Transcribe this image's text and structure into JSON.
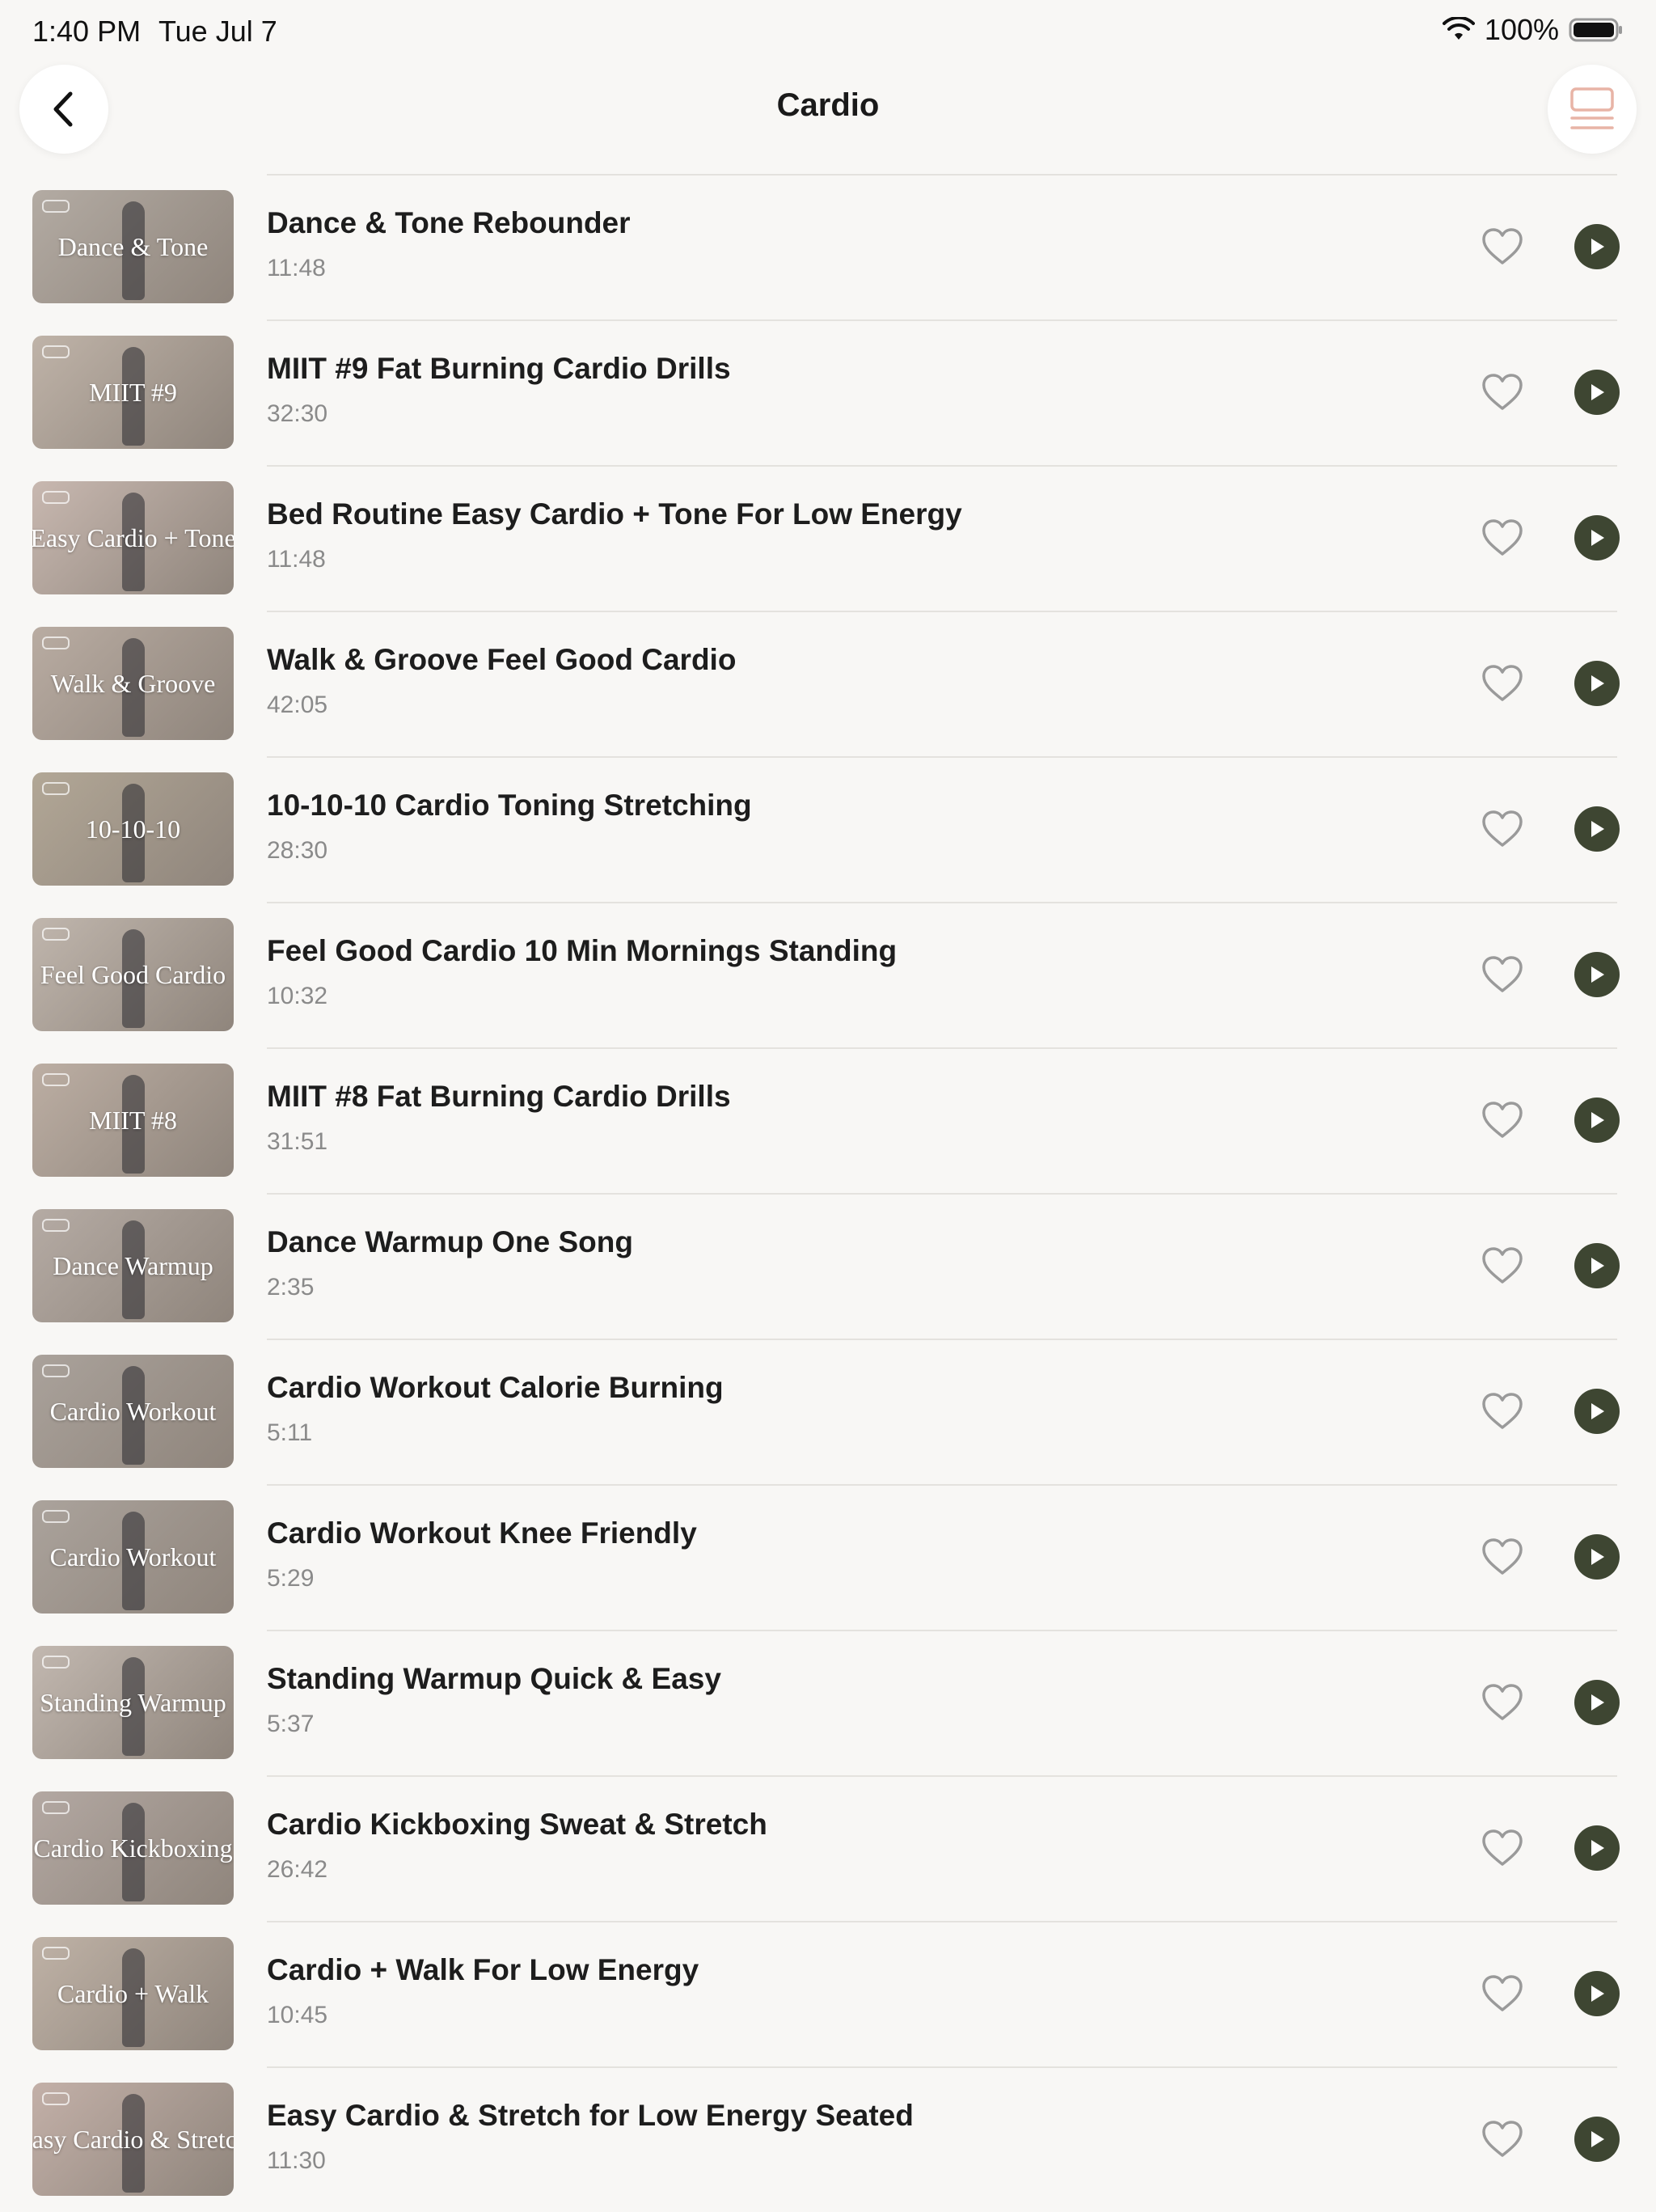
{
  "status_bar": {
    "time": "1:40 PM",
    "date": "Tue Jul 7",
    "battery": "100%"
  },
  "header": {
    "title": "Cardio",
    "back_icon": "chevron-left-icon",
    "layout_icon": "list-layout-icon"
  },
  "colors": {
    "background": "#f8f7f5",
    "play_button": "#3e4632",
    "heart_outline": "#9a9a9a",
    "layout_icon": "#e8b4a6"
  },
  "workouts": [
    {
      "title": "Dance & Tone Rebounder",
      "duration": "11:48",
      "thumb_text": "Dance & Tone",
      "thumb_color": "#b3aba3"
    },
    {
      "title": "MIIT #9 Fat Burning Cardio Drills",
      "duration": "32:30",
      "thumb_text": "MIIT #9",
      "thumb_color": "#bfb3a8"
    },
    {
      "title": "Bed Routine Easy Cardio + Tone For Low Energy",
      "duration": "11:48",
      "thumb_text": "Easy Cardio + Tone",
      "thumb_color": "#c8b8b0"
    },
    {
      "title": "Walk & Groove Feel Good Cardio",
      "duration": "42:05",
      "thumb_text": "Walk & Groove",
      "thumb_color": "#b9aca2"
    },
    {
      "title": "10-10-10 Cardio Toning Stretching",
      "duration": "28:30",
      "thumb_text": "10-10-10",
      "thumb_color": "#b2a796"
    },
    {
      "title": "Feel Good Cardio 10 Min Mornings Standing",
      "duration": "10:32",
      "thumb_text": "Feel Good Cardio",
      "thumb_color": "#c0b6ad"
    },
    {
      "title": "MIIT #8 Fat Burning Cardio Drills",
      "duration": "31:51",
      "thumb_text": "MIIT #8",
      "thumb_color": "#bcaea3"
    },
    {
      "title": "Dance Warmup One Song",
      "duration": "2:35",
      "thumb_text": "Dance Warmup",
      "thumb_color": "#b5aba4"
    },
    {
      "title": "Cardio Workout Calorie Burning",
      "duration": "5:11",
      "thumb_text": "Cardio Workout",
      "thumb_color": "#aaa29b"
    },
    {
      "title": "Cardio Workout Knee Friendly",
      "duration": "5:29",
      "thumb_text": "Cardio Workout",
      "thumb_color": "#aba39c"
    },
    {
      "title": "Standing Warmup Quick & Easy",
      "duration": "5:37",
      "thumb_text": "Standing Warmup",
      "thumb_color": "#c2b8b0"
    },
    {
      "title": "Cardio Kickboxing Sweat & Stretch",
      "duration": "26:42",
      "thumb_text": "Cardio Kickboxing",
      "thumb_color": "#b3a8a2"
    },
    {
      "title": "Cardio + Walk For Low Energy",
      "duration": "10:45",
      "thumb_text": "Cardio + Walk",
      "thumb_color": "#bfb2a6"
    },
    {
      "title": "Easy Cardio & Stretch for Low Energy Seated",
      "duration": "11:30",
      "thumb_text": "Easy Cardio & Stretch",
      "thumb_color": "#c3b0a8"
    }
  ]
}
